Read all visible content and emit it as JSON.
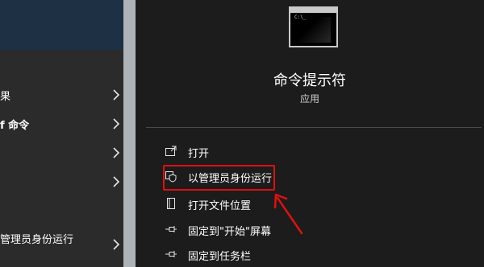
{
  "left_pane": {
    "rows": [
      {
        "label": "果",
        "bold": false
      },
      {
        "label": "f 命令",
        "bold": true
      },
      {
        "label": "",
        "bold": false
      },
      {
        "label": "",
        "bold": false
      },
      {
        "label": "管理员身份运行",
        "bold": false
      }
    ]
  },
  "app": {
    "name": "命令提示符",
    "type": "应用",
    "icon": "command-prompt-icon"
  },
  "actions": [
    {
      "label": "打开",
      "icon": "open-icon"
    },
    {
      "label": "以管理员身份运行",
      "icon": "shield-icon"
    },
    {
      "label": "打开文件位置",
      "icon": "file-location-icon"
    },
    {
      "label": "固定到\"开始\"屏幕",
      "icon": "pin-icon"
    },
    {
      "label": "固定到任务栏",
      "icon": "pin-icon"
    }
  ],
  "annotation": {
    "highlight_color": "#e01010",
    "highlighted_action": "以管理员身份运行"
  }
}
